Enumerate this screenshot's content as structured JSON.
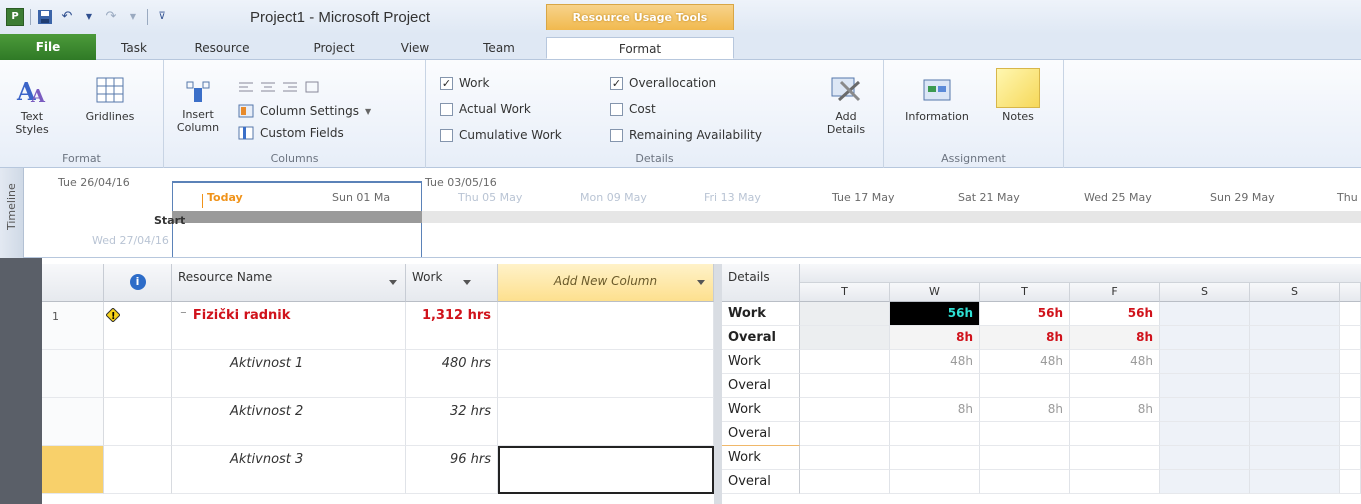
{
  "window": {
    "app_letter": "P",
    "title": "Project1  -  Microsoft Project",
    "context_tab": "Resource Usage Tools"
  },
  "tabs": [
    "File",
    "Task",
    "Resource",
    "Project",
    "View",
    "Team",
    "Format"
  ],
  "ribbon": {
    "format_group": {
      "label": "Format",
      "text_styles": "Text Styles",
      "gridlines": "Gridlines"
    },
    "columns_group": {
      "label": "Columns",
      "insert_column": "Insert Column",
      "column_settings": "Column Settings",
      "custom_fields": "Custom Fields"
    },
    "details_group": {
      "label": "Details",
      "work": "Work",
      "actual_work": "Actual Work",
      "cumulative_work": "Cumulative Work",
      "overallocation": "Overallocation",
      "cost": "Cost",
      "remaining_availability": "Remaining Availability",
      "add_details": "Add Details"
    },
    "assignment_group": {
      "label": "Assignment",
      "information": "Information",
      "notes": "Notes"
    }
  },
  "timeline": {
    "side_label": "Timeline",
    "start_date": "Tue 26/04/16",
    "today": "Today",
    "sun01": "Sun 01 Ma",
    "end_date": "Tue 03/05/16",
    "thu05": "Thu 05 May",
    "mon09": "Mon 09 May",
    "fri13": "Fri 13 May",
    "tue17": "Tue 17 May",
    "sat21": "Sat 21 May",
    "wed25": "Wed 25 May",
    "sun29": "Sun 29 May",
    "thu": "Thu",
    "start_label": "Start",
    "start_date_below": "Wed 27/04/16"
  },
  "table": {
    "headers": {
      "resource_name": "Resource Name",
      "work": "Work",
      "add_new": "Add New Column",
      "details": "Details"
    },
    "rows": [
      {
        "num": "1",
        "name": "Fizički radnik",
        "work": "1,312 hrs"
      },
      {
        "num": "",
        "name": "Aktivnost 1",
        "work": "480 hrs"
      },
      {
        "num": "",
        "name": "Aktivnost 2",
        "work": "32 hrs"
      },
      {
        "num": "",
        "name": "Aktivnost 3",
        "work": "96 hrs"
      }
    ]
  },
  "timephased": {
    "days": [
      "T",
      "W",
      "T",
      "F",
      "S",
      "S",
      ""
    ],
    "detail_labels": [
      "Work",
      "Overal",
      "Work",
      "Overal",
      "Work",
      "Overal",
      "Work",
      "Overal"
    ],
    "rows": [
      [
        "",
        "56h",
        "56h",
        "56h",
        "",
        "",
        ""
      ],
      [
        "",
        "8h",
        "8h",
        "8h",
        "",
        "",
        ""
      ],
      [
        "",
        "48h",
        "48h",
        "48h",
        "",
        "",
        ""
      ],
      [
        "",
        "",
        "",
        "",
        "",
        "",
        ""
      ],
      [
        "",
        "8h",
        "8h",
        "8h",
        "",
        "",
        ""
      ],
      [
        "",
        "",
        "",
        "",
        "",
        "",
        ""
      ],
      [
        "",
        "",
        "",
        "",
        "",
        "",
        ""
      ],
      [
        "",
        "",
        "",
        "",
        "",
        "",
        ""
      ]
    ]
  }
}
